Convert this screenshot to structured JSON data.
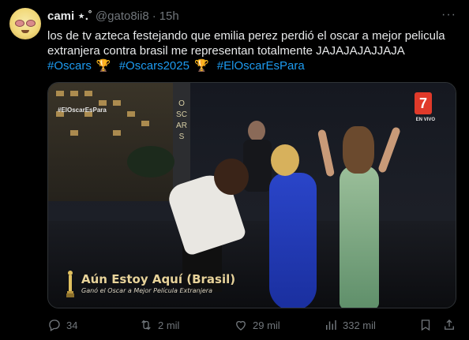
{
  "author": {
    "name": "cami ⋆.˚",
    "handle": "@gato8ii8",
    "separator": "·",
    "time": "15h"
  },
  "tweet": {
    "text": "los de tv azteca festejando que emilia perez perdió el oscar a mejor pelicula extranjera contra brasil me representan totalmente JAJAJAJAJJAJA",
    "hashtags": [
      "#Oscars",
      "#Oscars2025",
      "#ElOscarEsPara"
    ]
  },
  "video": {
    "hashtag_overlay": "#ElOscarEsPara",
    "logo_text": "7",
    "live_label": "EN VIVO",
    "tower_text": "OSCARS",
    "lower_third_title": "Aún Estoy Aquí (Brasil)",
    "lower_third_subtitle": "Ganó el Oscar a Mejor Película Extranjera"
  },
  "actions": {
    "replies": "34",
    "reposts": "2 mil",
    "likes": "29 mil",
    "views": "332 mil"
  },
  "colors": {
    "background": "#000000",
    "text": "#e7e9ea",
    "muted": "#71767b",
    "link": "#1d9bf0"
  },
  "icons": [
    "more-icon",
    "reply-icon",
    "repost-icon",
    "like-icon",
    "views-icon",
    "bookmark-icon",
    "share-icon",
    "trophy-icon"
  ]
}
